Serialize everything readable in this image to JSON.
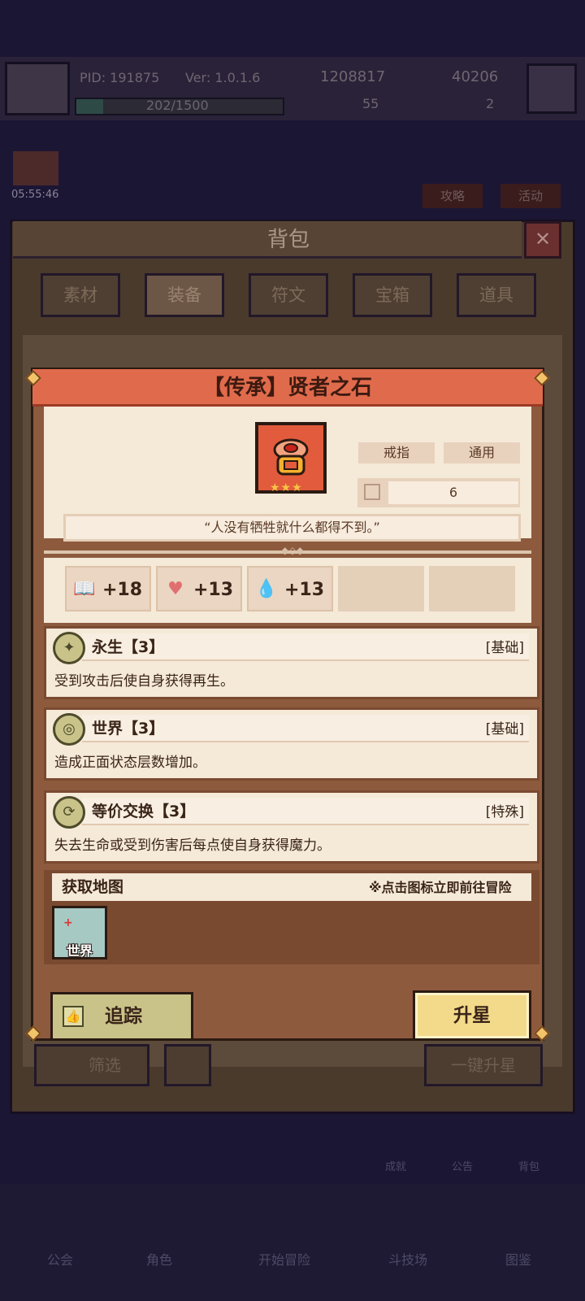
{
  "top_bar": {
    "pid": "PID: 191875",
    "version": "Ver: 1.0.1.6",
    "gold": "1208817",
    "gems": "40206",
    "exp": "202/1500",
    "stat_a": "55",
    "stat_b": "2",
    "timer": "05:55:46"
  },
  "side_buttons": {
    "guide": "攻略",
    "event": "活动"
  },
  "backpack": {
    "title": "背包",
    "close_icon": "✕",
    "tabs": [
      {
        "label": "素材",
        "selected": false
      },
      {
        "label": "装备",
        "selected": true
      },
      {
        "label": "符文",
        "selected": false
      },
      {
        "label": "宝箱",
        "selected": false
      },
      {
        "label": "道具",
        "selected": false
      }
    ],
    "filter": "筛选",
    "upstar_all": "一键升星"
  },
  "item": {
    "title": "【传承】贤者之石",
    "stars": "★★★",
    "slot_tag": "戒指",
    "class_tag": "通用",
    "level": "6",
    "quote": "“人没有牺牲就什么都得不到。”",
    "stats": [
      {
        "icon": "book-icon",
        "glyph": "📖",
        "value": "+18"
      },
      {
        "icon": "heart-icon",
        "glyph": "♥",
        "value": "+13"
      },
      {
        "icon": "water-drop-icon",
        "glyph": "💧",
        "value": "+13"
      }
    ]
  },
  "skills": [
    {
      "name": "永生【3】",
      "type": "[基础]",
      "desc": "受到攻击后使自身获得再生。",
      "glyph": "✦"
    },
    {
      "name": "世界【3】",
      "type": "[基础]",
      "desc": "造成正面状态层数增加。",
      "glyph": "◎"
    },
    {
      "name": "等价交换【3】",
      "type": "[特殊]",
      "desc": "失去生命或受到伤害后每点使自身获得魔力。",
      "glyph": "⟳"
    }
  ],
  "map": {
    "title": "获取地图",
    "hint": "※点击图标立即前往冒险",
    "tile_label": "世界",
    "tile_mark": "+"
  },
  "actions": {
    "track": "追踪",
    "upstar": "升星"
  },
  "bottom_nav": [
    "公会",
    "角色",
    "开始冒险",
    "斗技场",
    "图鉴"
  ],
  "right_dock": [
    "成就",
    "公告",
    "背包"
  ],
  "colors": {
    "title_bar": "#e06b4c",
    "card_bg": "#f5e9d8",
    "accent_button": "#f3d98a",
    "skill_icon": "#c9c38a"
  }
}
